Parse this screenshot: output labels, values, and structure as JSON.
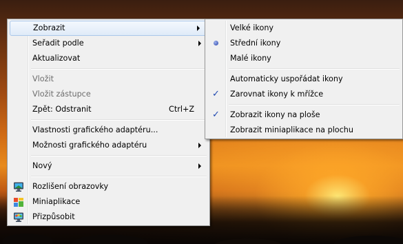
{
  "context_menu": {
    "items": [
      {
        "label": "Zobrazit",
        "submenu": true,
        "highlighted": true
      },
      {
        "label": "Seřadit podle",
        "submenu": true
      },
      {
        "label": "Aktualizovat"
      },
      {
        "label": "Vložit",
        "disabled": true
      },
      {
        "label": "Vložit zástupce",
        "disabled": true
      },
      {
        "label": "Zpět: Odstranit",
        "shortcut": "Ctrl+Z"
      },
      {
        "label": "Vlastnosti grafického adaptéru..."
      },
      {
        "label": "Možnosti grafického adaptéru",
        "submenu": true
      },
      {
        "label": "Nový",
        "submenu": true
      },
      {
        "label": "Rozlišení obrazovky",
        "icon": "monitor-icon"
      },
      {
        "label": "Miniaplikace",
        "icon": "gadgets-icon"
      },
      {
        "label": "Přizpůsobit",
        "icon": "personalize-icon"
      }
    ]
  },
  "view_submenu": {
    "items": [
      {
        "label": "Velké ikony"
      },
      {
        "label": "Střední ikony",
        "state": "radio-selected"
      },
      {
        "label": "Malé ikony"
      },
      {
        "label": "Automaticky uspořádat ikony"
      },
      {
        "label": "Zarovnat ikony k mřížce",
        "state": "checked"
      },
      {
        "label": "Zobrazit ikony na ploše",
        "state": "checked"
      },
      {
        "label": "Zobrazit miniaplikace na plochu"
      }
    ]
  },
  "colors": {
    "menu_bg": "#f0f0f0",
    "menu_border": "#979797",
    "highlight_border": "#a9c7ea",
    "disabled_text": "#6d6d6d",
    "check_color": "#1f48b0"
  }
}
